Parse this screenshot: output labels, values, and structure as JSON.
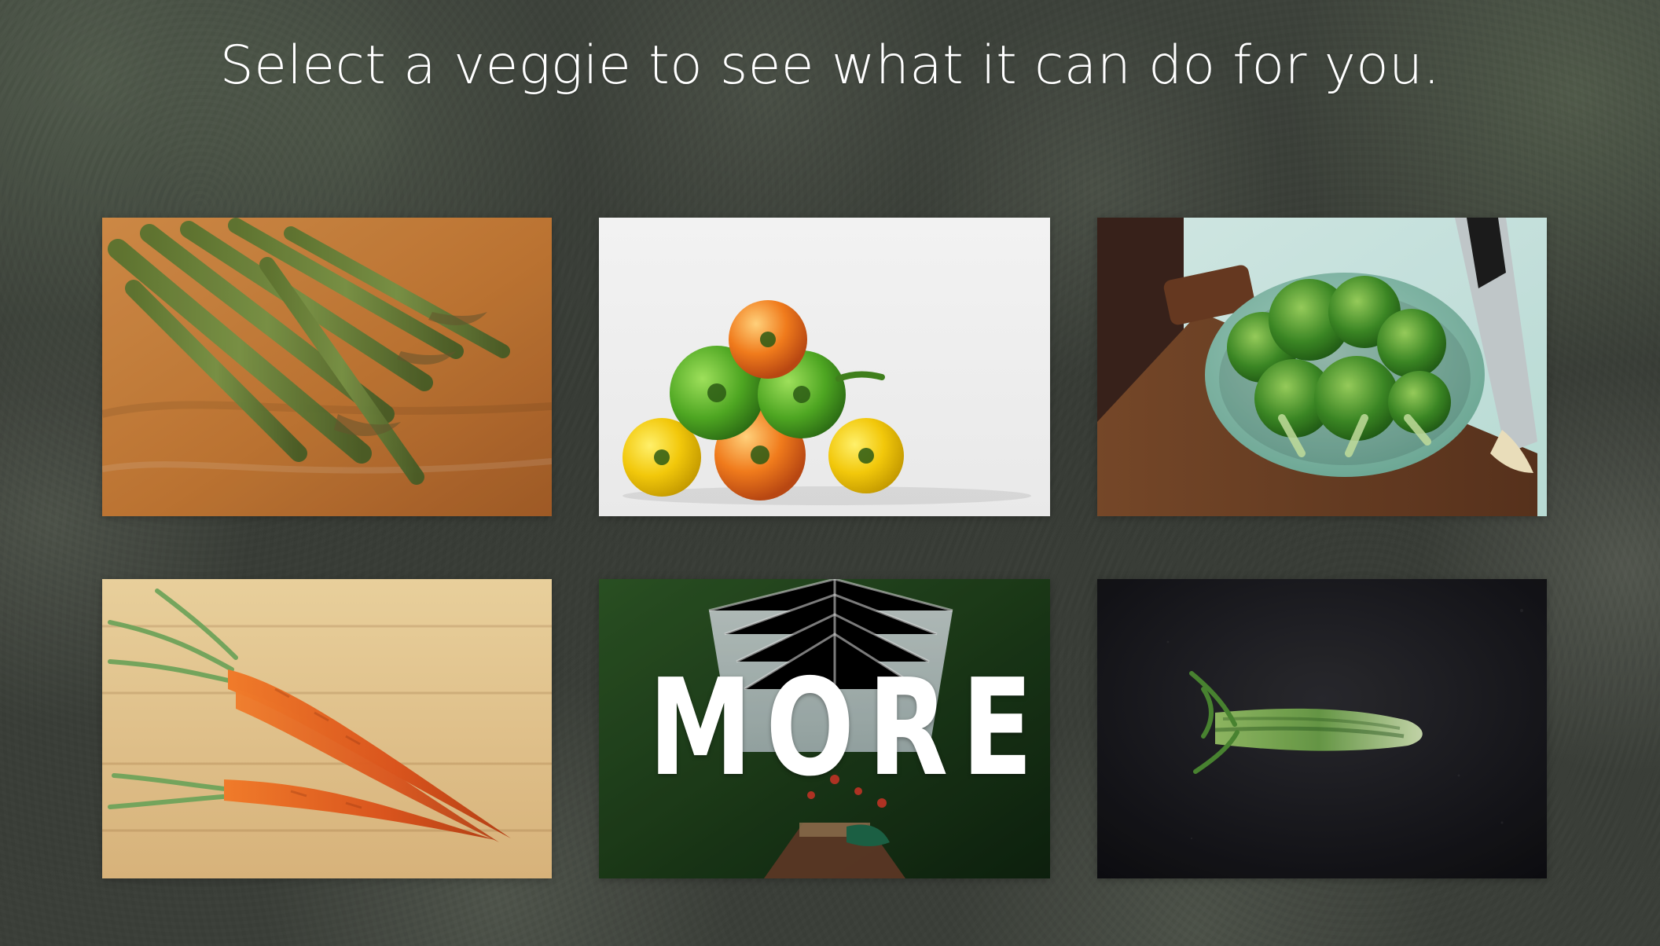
{
  "page": {
    "heading": "Select a veggie to see what it can do for you."
  },
  "tiles": [
    {
      "name": "asparagus"
    },
    {
      "name": "bell-peppers"
    },
    {
      "name": "broccoli"
    },
    {
      "name": "carrots"
    },
    {
      "name": "more",
      "label": "MORE"
    },
    {
      "name": "celery"
    }
  ],
  "colors": {
    "background": "#3a3e37",
    "heading": "#ffffff"
  }
}
